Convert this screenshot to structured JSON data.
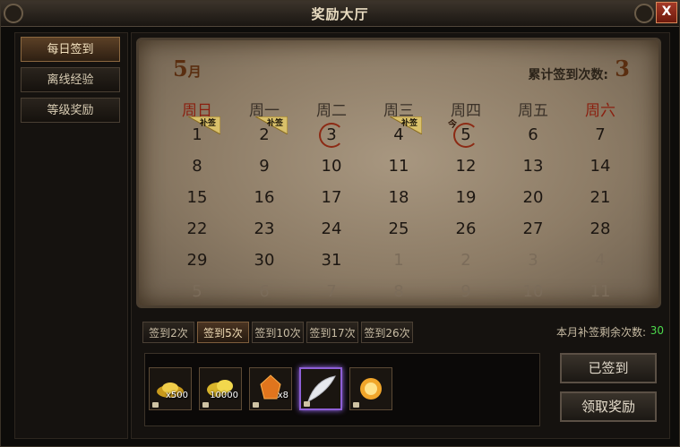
{
  "window": {
    "title": "奖励大厅",
    "close_label": "X"
  },
  "sidebar": {
    "items": [
      {
        "label": "每日签到",
        "active": true
      },
      {
        "label": "离线经验",
        "active": false
      },
      {
        "label": "等级奖励",
        "active": false
      }
    ]
  },
  "calendar": {
    "month_number": "5",
    "month_suffix": "月",
    "count_label": "累计签到次数:",
    "count_value": "3",
    "weekdays": [
      "周日",
      "周一",
      "周二",
      "周三",
      "周四",
      "周五",
      "周六"
    ],
    "today_marker": "今",
    "makeup_label": "补签",
    "weeks": [
      [
        "1",
        "2",
        "3",
        "4",
        "5",
        "6",
        "7"
      ],
      [
        "8",
        "9",
        "10",
        "11",
        "12",
        "13",
        "14"
      ],
      [
        "15",
        "16",
        "17",
        "18",
        "19",
        "20",
        "21"
      ],
      [
        "22",
        "23",
        "24",
        "25",
        "26",
        "27",
        "28"
      ],
      [
        "29",
        "30",
        "31",
        "1",
        "2",
        "3",
        "4"
      ],
      [
        "5",
        "6",
        "7",
        "8",
        "9",
        "10",
        "11"
      ]
    ]
  },
  "tabs": [
    {
      "label": "签到2次",
      "active": false
    },
    {
      "label": "签到5次",
      "active": true
    },
    {
      "label": "签到10次",
      "active": false
    },
    {
      "label": "签到17次",
      "active": false
    },
    {
      "label": "签到26次",
      "active": false
    }
  ],
  "remaining": {
    "label": "本月补签剩余次数:",
    "value": "30"
  },
  "rewards": [
    {
      "icon": "gold-ingot-icon",
      "quantity": "x500"
    },
    {
      "icon": "gold-pile-icon",
      "quantity": "10000"
    },
    {
      "icon": "orange-gem-icon",
      "quantity": "x8"
    },
    {
      "icon": "white-feather-icon",
      "quantity": ""
    },
    {
      "icon": "golden-orb-icon",
      "quantity": ""
    }
  ],
  "actions": {
    "signed_label": "已签到",
    "claim_label": "领取奖励"
  }
}
